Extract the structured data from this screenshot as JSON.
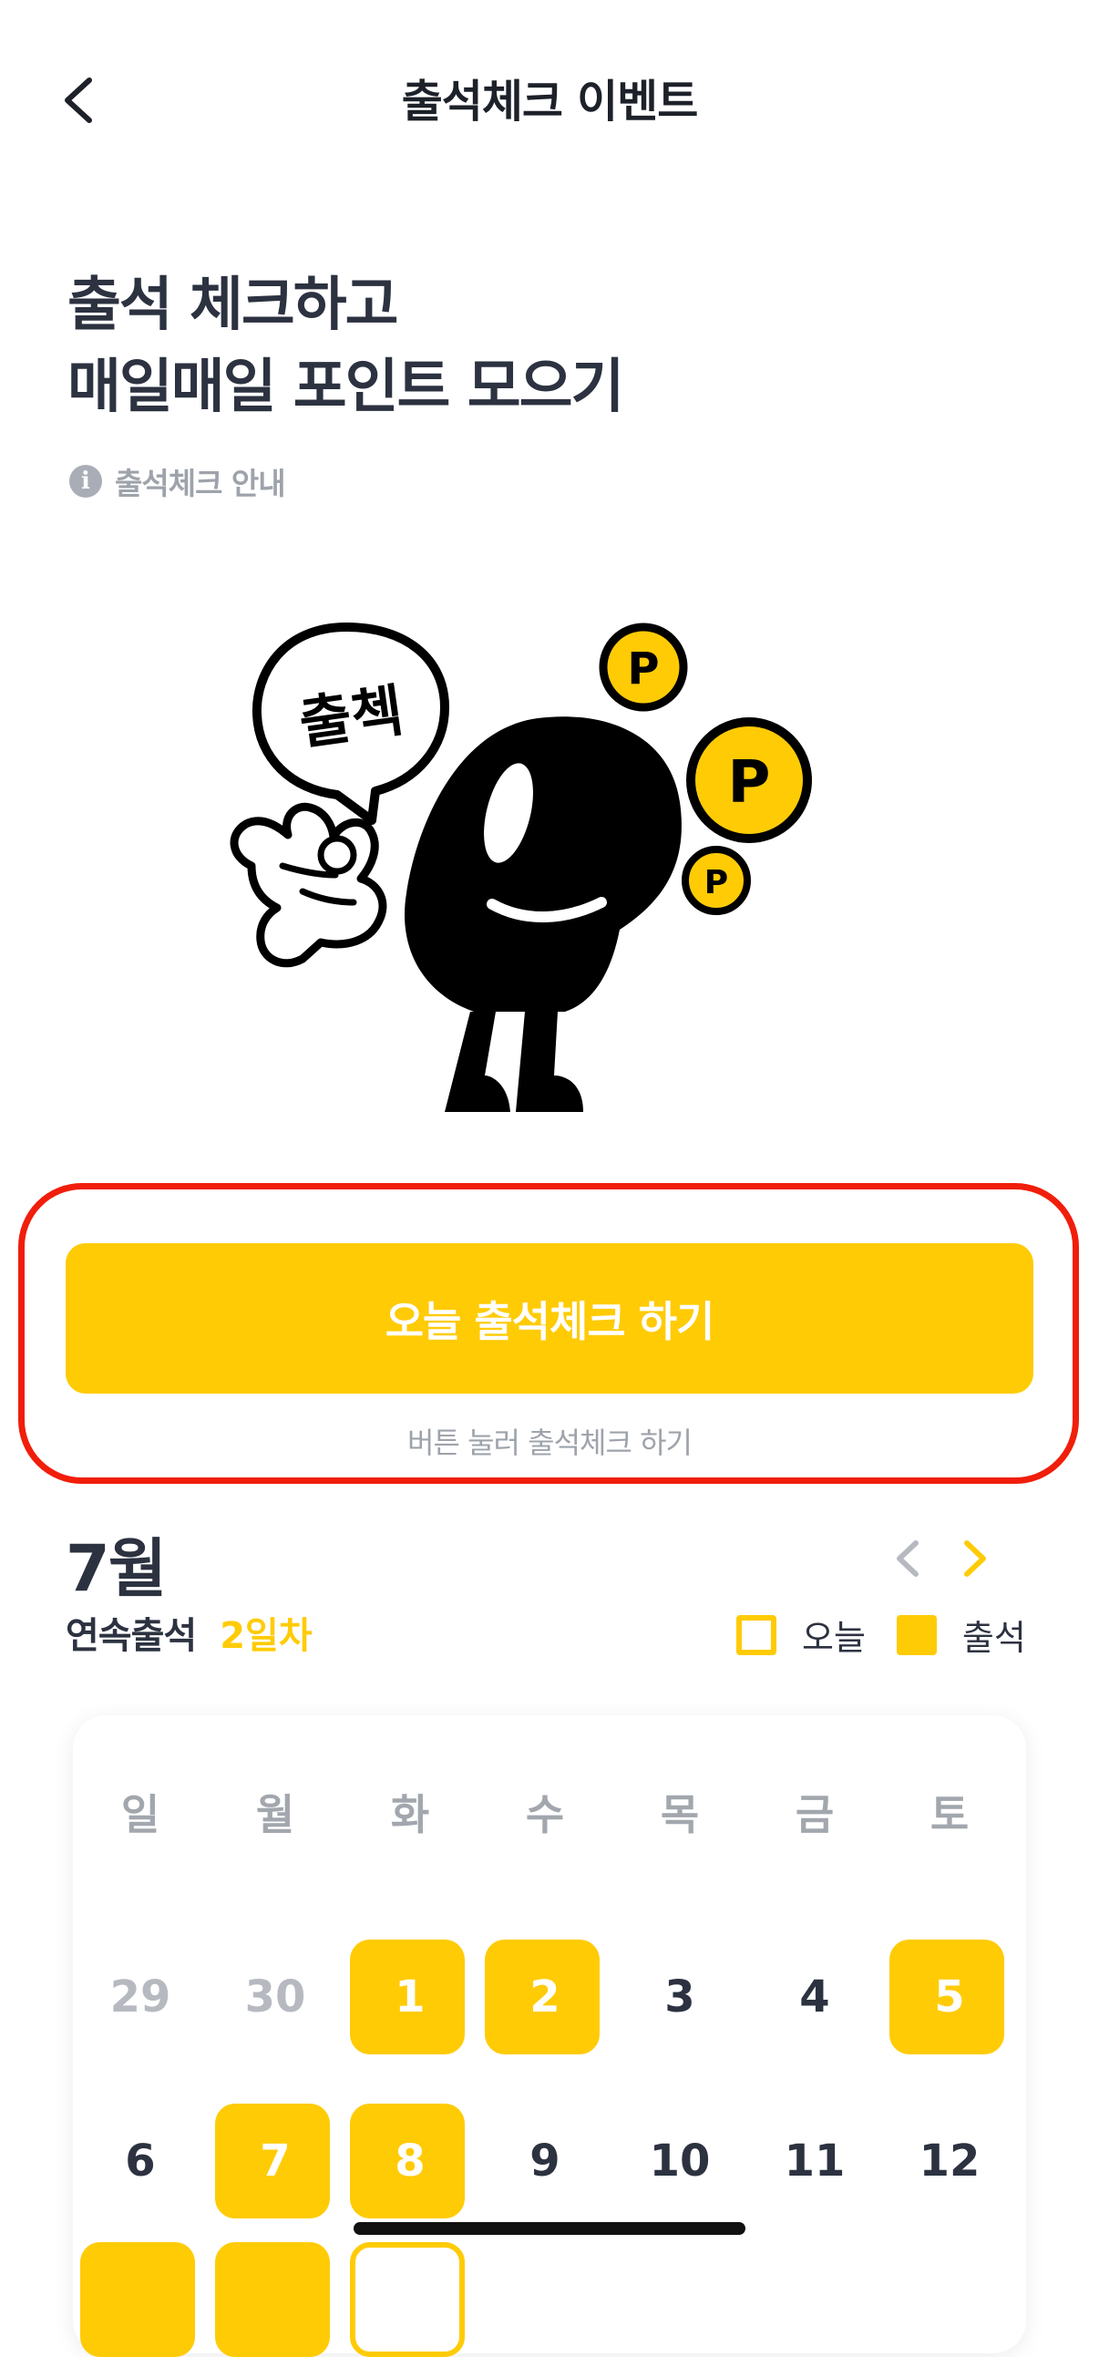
{
  "header": {
    "title": "출석체크 이벤트",
    "back_icon": "chevron-left-icon"
  },
  "hero": {
    "title_line1": "출석 체크하고",
    "title_line2": "매일매일 포인트 모으기",
    "info_label": "출석체크 안내",
    "info_icon": "info-icon"
  },
  "mascot": {
    "bubble_text": "출첵",
    "coin_letter": "P",
    "colors": {
      "coin": "#ffcb05",
      "ink": "#000000"
    }
  },
  "cta": {
    "button_label": "오늘 출석체크 하기",
    "hint": "버튼 눌러 출석체크 하기"
  },
  "calendar": {
    "month_label": "7월",
    "streak_label": "연속출석",
    "streak_value": "2일차",
    "legend": {
      "today": "오늘",
      "attended": "출석"
    },
    "weekdays": [
      "일",
      "월",
      "화",
      "수",
      "목",
      "금",
      "토"
    ],
    "weeks": [
      [
        {
          "day": "29",
          "state": "muted"
        },
        {
          "day": "30",
          "state": "muted"
        },
        {
          "day": "1",
          "state": "attended"
        },
        {
          "day": "2",
          "state": "attended"
        },
        {
          "day": "3",
          "state": "normal"
        },
        {
          "day": "4",
          "state": "normal"
        },
        {
          "day": "5",
          "state": "attended"
        }
      ],
      [
        {
          "day": "6",
          "state": "normal"
        },
        {
          "day": "7",
          "state": "attended"
        },
        {
          "day": "8",
          "state": "attended"
        },
        {
          "day": "9",
          "state": "normal"
        },
        {
          "day": "10",
          "state": "normal"
        },
        {
          "day": "11",
          "state": "normal"
        },
        {
          "day": "12",
          "state": "normal"
        }
      ]
    ],
    "partial_row": [
      {
        "state": "attended"
      },
      {
        "state": "attended"
      },
      {
        "state": "today"
      }
    ]
  },
  "colors": {
    "accent": "#ffcb05",
    "text": "#2c3240",
    "muted": "#b6bac0",
    "highlight": "#f01e0a"
  }
}
